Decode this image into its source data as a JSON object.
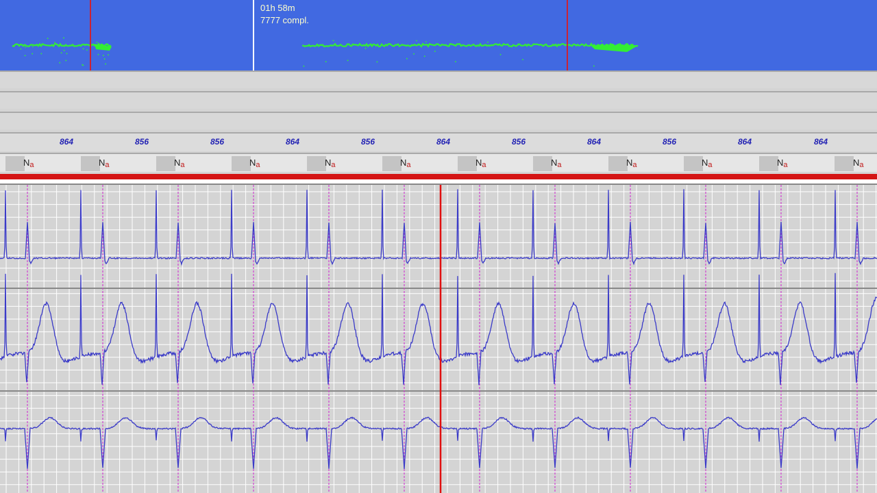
{
  "trend_panel": {
    "duration_label": "01h 58m",
    "complexes_label": "7777 compl.",
    "background_color": "#4169e1",
    "trace_color": "#33ee33",
    "cursor_color": "#cc2233"
  },
  "rr_intervals": [
    "864",
    "856",
    "856",
    "864",
    "856",
    "864",
    "856",
    "864",
    "856",
    "864",
    "864"
  ],
  "beat_labels": [
    {
      "main": "N",
      "sub": "a"
    },
    {
      "main": "N",
      "sub": "a"
    },
    {
      "main": "N",
      "sub": "a"
    },
    {
      "main": "N",
      "sub": "a"
    },
    {
      "main": "N",
      "sub": "a"
    },
    {
      "main": "N",
      "sub": "a"
    },
    {
      "main": "N",
      "sub": "a"
    },
    {
      "main": "N",
      "sub": "a"
    },
    {
      "main": "N",
      "sub": "a"
    },
    {
      "main": "N",
      "sub": "a"
    },
    {
      "main": "N",
      "sub": "a"
    },
    {
      "main": "N",
      "sub": "a"
    }
  ],
  "ecg": {
    "lead_count": 3,
    "trace_color": "#3a3ac8",
    "beat_marker_color": "#d040d0",
    "cursor_color": "#e01010",
    "grid_color": "#ffffff",
    "background_color": "#d4d4d4"
  }
}
